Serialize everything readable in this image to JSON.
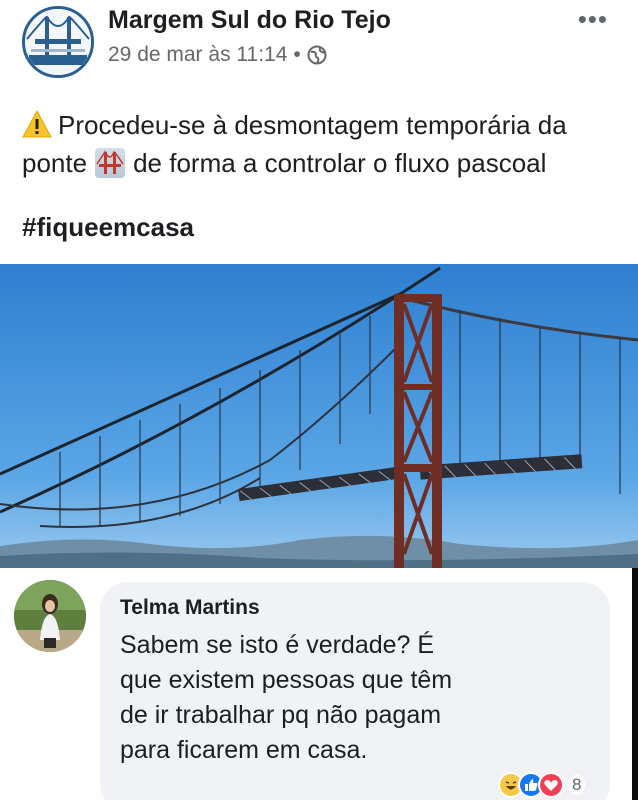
{
  "post": {
    "page_name": "Margem Sul do Rio Tejo",
    "timestamp": "29 de mar às 11:14",
    "separator": "•",
    "privacy_icon": "globe-icon",
    "more_icon": "•••",
    "text_line1": "Procedeu-se à desmontagem temporária da",
    "text_line2_a": "ponte",
    "text_line2_b": "de forma a controlar o fluxo pascoal",
    "hashtag": "#fiqueemcasa"
  },
  "comment": {
    "author": "Telma Martins",
    "text": "Sabem se isto é verdade? É que existem pessoas que têm de ir trabalhar pq não pagam para ficarem em casa.",
    "reaction_icons": [
      "haha-icon",
      "like-icon",
      "love-icon"
    ],
    "reaction_count": "8"
  },
  "colors": {
    "sky": "#3a86cf",
    "bridge_red": "#8a3a2e",
    "text": "#1c1e21",
    "muted": "#65676b",
    "bubble": "#f0f2f5"
  }
}
